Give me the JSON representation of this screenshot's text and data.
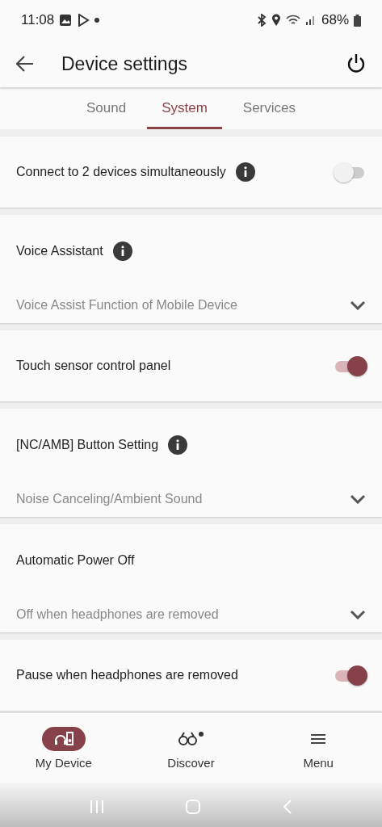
{
  "status_bar": {
    "time": "11:08",
    "battery": "68%"
  },
  "app_bar": {
    "title": "Device settings"
  },
  "tabs": [
    {
      "label": "Sound",
      "selected": false
    },
    {
      "label": "System",
      "selected": true
    },
    {
      "label": "Services",
      "selected": false
    }
  ],
  "settings": [
    {
      "kind": "toggle",
      "label": "Connect to 2 devices simultaneously",
      "info": true,
      "on": false
    },
    {
      "kind": "select",
      "label": "Voice Assistant",
      "info": true,
      "value": "Voice Assist Function of Mobile Device"
    },
    {
      "kind": "toggle",
      "label": "Touch sensor control panel",
      "info": false,
      "on": true
    },
    {
      "kind": "select",
      "label": "[NC/AMB] Button Setting",
      "info": true,
      "value": "Noise Canceling/Ambient Sound"
    },
    {
      "kind": "select",
      "label": "Automatic Power Off",
      "info": false,
      "value": "Off when headphones are removed"
    },
    {
      "kind": "toggle",
      "label": "Pause when headphones are removed",
      "info": false,
      "on": true
    }
  ],
  "bottom_nav": [
    {
      "kind": "device",
      "label": "My Device",
      "selected": true
    },
    {
      "kind": "discover",
      "label": "Discover",
      "selected": false
    },
    {
      "kind": "menu",
      "label": "Menu",
      "selected": false
    }
  ]
}
